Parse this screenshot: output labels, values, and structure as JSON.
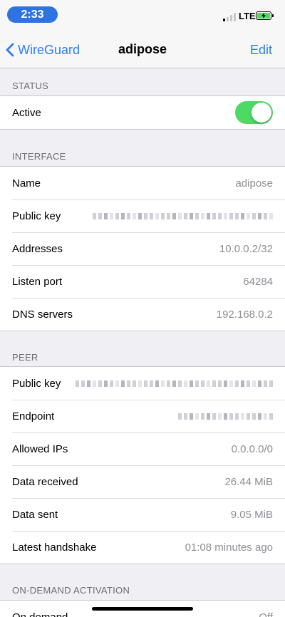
{
  "status_bar": {
    "time": "2:33",
    "network": "LTE",
    "signal_bars_active": 1,
    "signal_bars_total": 4,
    "battery_color": "#4cd964"
  },
  "nav": {
    "back_label": "WireGuard",
    "title": "adipose",
    "edit_label": "Edit"
  },
  "status": {
    "header": "STATUS",
    "rows": [
      {
        "label": "Active",
        "toggle_on": true
      }
    ]
  },
  "interface": {
    "header": "INTERFACE",
    "rows": [
      {
        "label": "Name",
        "value": "adipose"
      },
      {
        "label": "Public key",
        "value": ""
      },
      {
        "label": "Addresses",
        "value": "10.0.0.2/32"
      },
      {
        "label": "Listen port",
        "value": "64284"
      },
      {
        "label": "DNS servers",
        "value": "192.168.0.2"
      }
    ]
  },
  "peer": {
    "header": "PEER",
    "rows": [
      {
        "label": "Public key",
        "value": ""
      },
      {
        "label": "Endpoint",
        "value": ""
      },
      {
        "label": "Allowed IPs",
        "value": "0.0.0.0/0"
      },
      {
        "label": "Data received",
        "value": "26.44 MiB"
      },
      {
        "label": "Data sent",
        "value": "9.05 MiB"
      },
      {
        "label": "Latest handshake",
        "value": "01:08 minutes ago"
      }
    ]
  },
  "on_demand": {
    "header": "ON-DEMAND ACTIVATION",
    "rows": [
      {
        "label": "On demand",
        "value": "Off"
      }
    ]
  },
  "colors": {
    "accent": "#2f7cf6",
    "toggle_on": "#4cd964",
    "time_pill": "#2e73e0"
  }
}
